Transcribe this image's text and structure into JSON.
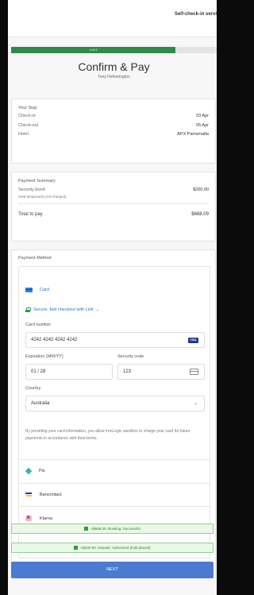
{
  "header": {
    "title": "Self-check-in servi"
  },
  "progress": {
    "label": "4 of 5",
    "fraction": 0.8
  },
  "page": {
    "heading": "Confirm & Pay",
    "guest_name": "Tony Hetherington"
  },
  "stay": {
    "title": "Your Stay",
    "rows": [
      {
        "label": "Check-in",
        "value": "03 Apr"
      },
      {
        "label": "Check-out",
        "value": "05 Apr"
      },
      {
        "label": "Hotel",
        "value": "APX Parramatta"
      }
    ]
  },
  "payment_summary": {
    "title": "Payment Summary",
    "security_bond_label": "Security bond",
    "security_bond_value": "$200.00",
    "held_note": "Held temporarily (not charged)",
    "total_label": "Total to pay",
    "total_value": "$668.09"
  },
  "payment_method": {
    "title": "Payment Method",
    "card_tab_label": "Card",
    "link_label": "Secure, fast checkout with Link",
    "card_number_label": "Card number",
    "card_number_value": "4242 4242 4242 4242",
    "card_brand": "VISA",
    "expiry_label": "Expiration (MM/YY)",
    "expiry_value": "01 / 28",
    "cvc_label": "Security code",
    "cvc_value": "123",
    "country_label": "Country",
    "country_value": "Australia",
    "legal_text": "By providing your card information, you allow IronLogic sandbox to charge your card for future payments in accordance with their terms.",
    "alternatives": [
      {
        "name": "Pix",
        "icon": "pix-icon"
      },
      {
        "name": "Bancontact",
        "icon": "bancontact-icon"
      },
      {
        "name": "Klarna",
        "icon": "klarna-icon"
      }
    ]
  },
  "statuses": [
    "A$668.09. Booking. Successful",
    "A$200.00. Deposit. Authorized (hold placed)"
  ],
  "actions": {
    "next_label": "NEXT"
  },
  "colors": {
    "progress": "#2f8b47",
    "accent": "#1a73e8",
    "button": "#4a7bd0",
    "status_border": "#8fd18f"
  }
}
